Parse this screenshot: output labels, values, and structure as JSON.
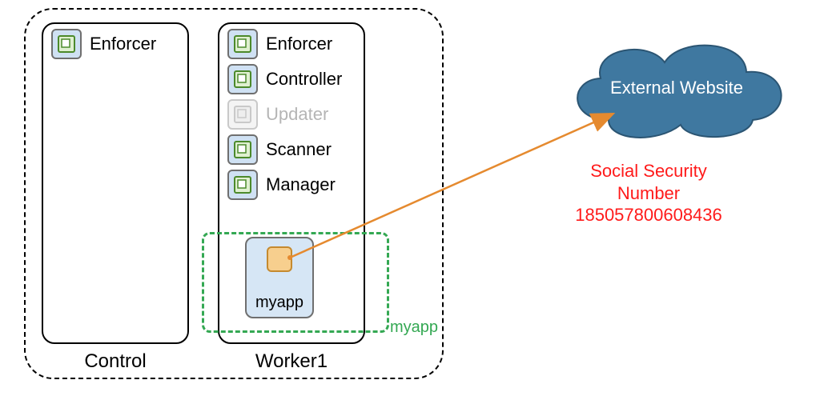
{
  "cluster": {
    "label": ""
  },
  "nodes": {
    "control": {
      "label": "Control",
      "components": [
        {
          "label": "Enforcer",
          "dim": false
        }
      ]
    },
    "worker1": {
      "label": "Worker1",
      "components": [
        {
          "label": "Enforcer",
          "dim": false
        },
        {
          "label": "Controller",
          "dim": false
        },
        {
          "label": "Updater",
          "dim": true
        },
        {
          "label": "Scanner",
          "dim": false
        },
        {
          "label": "Manager",
          "dim": false
        }
      ]
    }
  },
  "myapp": {
    "group_label": "myapp",
    "box_label": "myapp"
  },
  "cloud": {
    "label": "External Website"
  },
  "annotation": {
    "line1": "Social Security",
    "line2": "Number",
    "line3": "185057800608436"
  }
}
